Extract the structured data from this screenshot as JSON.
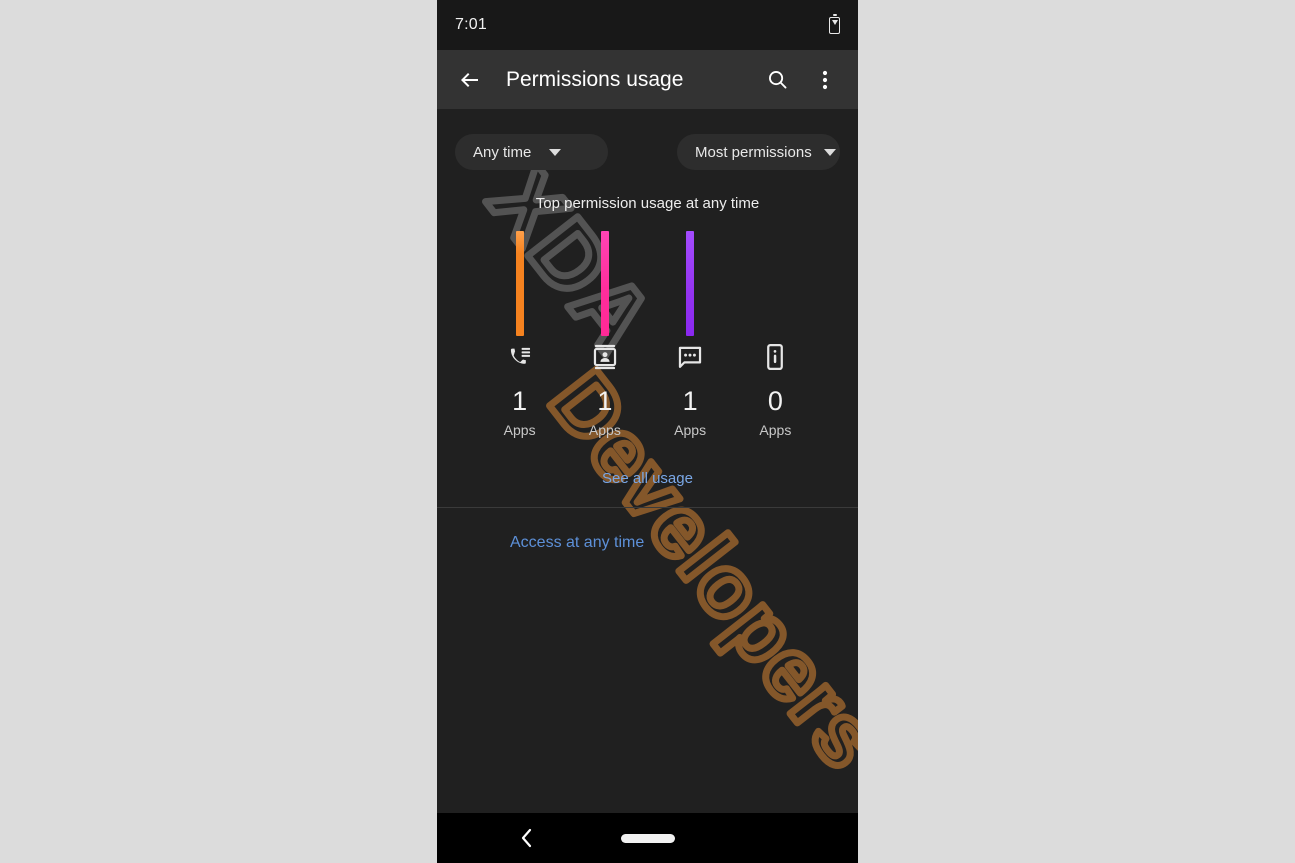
{
  "status_bar": {
    "time": "7:01",
    "battery_icon": "battery-charging-icon"
  },
  "app_bar": {
    "back_icon": "arrow-back-icon",
    "title": "Permissions usage",
    "search_icon": "search-icon",
    "overflow_icon": "more-vert-icon"
  },
  "filters": {
    "time_filter": {
      "value": "Any time",
      "caret_icon": "chevron-down-icon"
    },
    "sort_filter": {
      "value": "Most permissions",
      "caret_icon": "chevron-down-icon"
    }
  },
  "chart_heading": "Top permission usage at any time",
  "chart_data": {
    "type": "bar",
    "title": "Top permission usage at any time",
    "categories": [
      "Phone",
      "Contacts",
      "SMS",
      "Nearby devices"
    ],
    "icons": [
      "phone-call-log-icon",
      "contacts-card-icon",
      "sms-message-icon",
      "phone-device-info-icon"
    ],
    "values": [
      1,
      1,
      1,
      0
    ],
    "value_labels": [
      "1",
      "1",
      "1",
      "0"
    ],
    "unit_label": "Apps",
    "bar_colors": [
      "#f5821f",
      "#ff3aa0",
      "#9333f0",
      "#00000000"
    ],
    "bar_gradients": [
      [
        "#ffa04a",
        "#f5821f"
      ],
      [
        "#ff44b4",
        "#ff2996"
      ],
      [
        "#a44cff",
        "#8a28f0"
      ],
      [
        "#00000000",
        "#00000000"
      ]
    ],
    "ylim": [
      0,
      1
    ],
    "xlabel": "",
    "ylabel": "Apps",
    "grid": false,
    "legend": "none"
  },
  "links": {
    "see_all_usage": "See all usage",
    "access_at_any_time": "Access at any time"
  },
  "nav_bar": {
    "back_icon": "nav-back-chevron-icon",
    "home_icon": "nav-home-pill-icon"
  },
  "watermark": {
    "text": "XDA Developers",
    "front_color": "#8a5a2b",
    "back_color": "#6e6e6e"
  }
}
